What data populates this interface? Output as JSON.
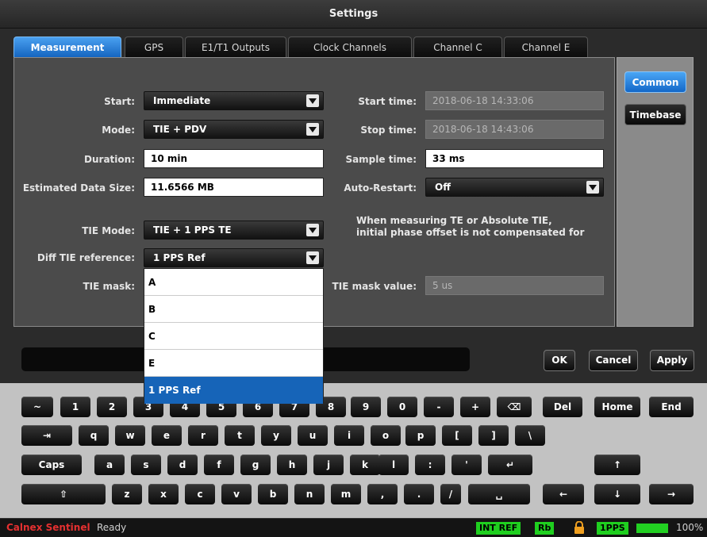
{
  "window": {
    "title": "Settings"
  },
  "tabs": [
    {
      "label": "Measurement",
      "active": true
    },
    {
      "label": "GPS"
    },
    {
      "label": "E1/T1 Outputs"
    },
    {
      "label": "Clock Channels"
    },
    {
      "label": "Channel C"
    },
    {
      "label": "Channel E"
    }
  ],
  "side": {
    "common": "Common",
    "timebase": "Timebase"
  },
  "form": {
    "start": {
      "label": "Start:",
      "value": "Immediate"
    },
    "mode": {
      "label": "Mode:",
      "value": "TIE + PDV"
    },
    "duration": {
      "label": "Duration:",
      "value": "10 min"
    },
    "data_size": {
      "label": "Estimated Data Size:",
      "value": "11.6566 MB"
    },
    "tie_mode": {
      "label": "TIE Mode:",
      "value": "TIE + 1 PPS TE"
    },
    "diff_tie": {
      "label": "Diff TIE reference:",
      "value": "1 PPS Ref"
    },
    "tie_mask": {
      "label": "TIE mask:"
    },
    "start_time": {
      "label": "Start time:",
      "value": "2018-06-18 14:33:06"
    },
    "stop_time": {
      "label": "Stop time:",
      "value": "2018-06-18 14:43:06"
    },
    "sample_time": {
      "label": "Sample time:",
      "value": "33 ms"
    },
    "auto_restart": {
      "label": "Auto-Restart:",
      "value": "Off"
    },
    "note_line1": "When measuring TE or Absolute TIE,",
    "note_line2": "initial phase offset is not compensated for",
    "tie_mask_value": {
      "label": "TIE mask value:",
      "value": "5 us"
    }
  },
  "dropdown_options": [
    "A",
    "B",
    "C",
    "E",
    "1 PPS Ref"
  ],
  "dropdown_selected": "1 PPS Ref",
  "actions": {
    "ok": "OK",
    "cancel": "Cancel",
    "apply": "Apply"
  },
  "keyboard": {
    "row1": [
      "~",
      "1",
      "2",
      "3",
      "4",
      "5",
      "6",
      "7",
      "8",
      "9",
      "0",
      "-",
      "+",
      "⌫",
      "Del",
      "Home",
      "End"
    ],
    "row2": [
      "⇥",
      "q",
      "w",
      "e",
      "r",
      "t",
      "y",
      "u",
      "i",
      "o",
      "p",
      "[",
      "]",
      "\\"
    ],
    "row3": [
      "Caps",
      "a",
      "s",
      "d",
      "f",
      "g",
      "h",
      "j",
      "k",
      "l",
      ":",
      "'",
      "↵",
      "↑"
    ],
    "row4": [
      "⇧",
      "z",
      "x",
      "c",
      "v",
      "b",
      "n",
      "m",
      ",",
      ".",
      "/",
      "␣",
      "←",
      "↓",
      "→"
    ]
  },
  "status": {
    "brand": "Calnex Sentinel",
    "state": "Ready",
    "int_ref": "INT REF",
    "rb": "Rb",
    "pps": "1PPS",
    "battery": "100%",
    "battery_level_pct": 100,
    "accent_color": "#1fcf1f",
    "lock_icon_color": "#f0a020"
  }
}
